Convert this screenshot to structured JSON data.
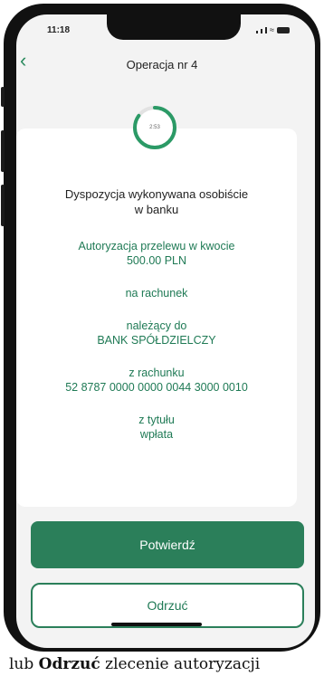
{
  "status_bar": {
    "time": "11:18"
  },
  "header": {
    "title": "Operacja nr 4"
  },
  "timer": {
    "value": "2:53",
    "progress": 0.85
  },
  "card": {
    "heading_line1": "Dyspozycja wykonywana osobiście",
    "heading_line2": "w banku",
    "auth_line1": "Autoryzacja przelewu w kwocie",
    "amount": "500.00 PLN",
    "to_account_label": "na rachunek",
    "owner_label": "należący do",
    "bank_name": "BANK SPÓŁDZIELCZY",
    "from_account_label": "z rachunku",
    "from_account_number": "52 8787 0000 0000 0044 3000 0010",
    "title_label": "z tytułu",
    "title_value": "wpłata"
  },
  "actions": {
    "confirm_label": "Potwierdź",
    "reject_label": "Odrzuć"
  },
  "caption": {
    "prefix": "lub ",
    "bold": "Odrzuć",
    "suffix": " zlecenie autoryzacji"
  },
  "colors": {
    "accent": "#2b7f5a",
    "accent_text": "#1f7a55"
  }
}
